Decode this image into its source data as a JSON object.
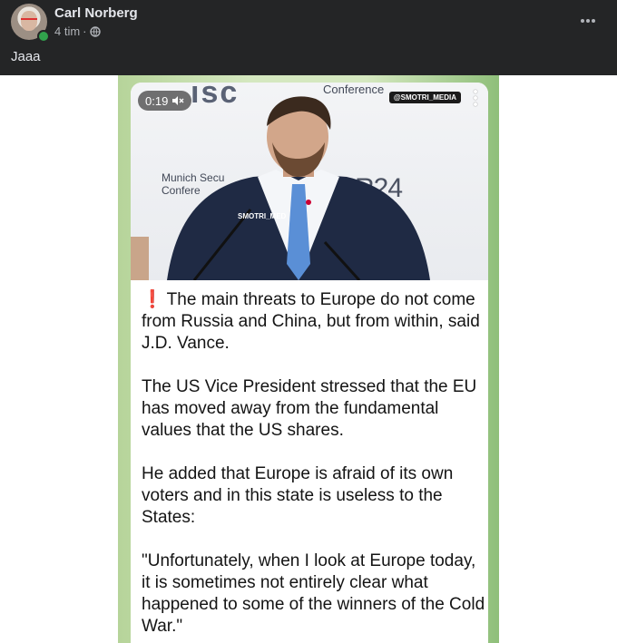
{
  "post": {
    "author": "Carl Norberg",
    "time": "4 tim",
    "separator": "·",
    "text": "Jaaa",
    "more_icon": "ellipsis-icon",
    "privacy_icon": "globe-icon"
  },
  "video": {
    "time": "0:19",
    "mute_icon": "speaker-muted-icon",
    "handle": "@SMOTRI_MEDIA",
    "backdrop": {
      "top": "ısc",
      "conference": "Conference",
      "munich_line1": "Munich Secu",
      "munich_line2": "Confere",
      "br24": "BR24",
      "podium_mark": "SMOTRI_MED"
    }
  },
  "article": {
    "bang": "❗",
    "p1": "The main threats to Europe do not come from Russia and China, but from within, said J.D. Vance.",
    "p2": "The US Vice President stressed that the EU has moved away from the fundamental values that the US shares.",
    "p3": "He added that Europe is afraid of its own voters and in this state is useless to the States:",
    "p4": "\"Unfortunately, when I look at Europe today, it is sometimes not entirely clear what happened to some of the winners of the Cold War.\""
  },
  "colors": {
    "header_bg": "#242526",
    "online": "#31a24c",
    "frame_green": "#b6d49a",
    "accent_red": "#e0312b"
  }
}
